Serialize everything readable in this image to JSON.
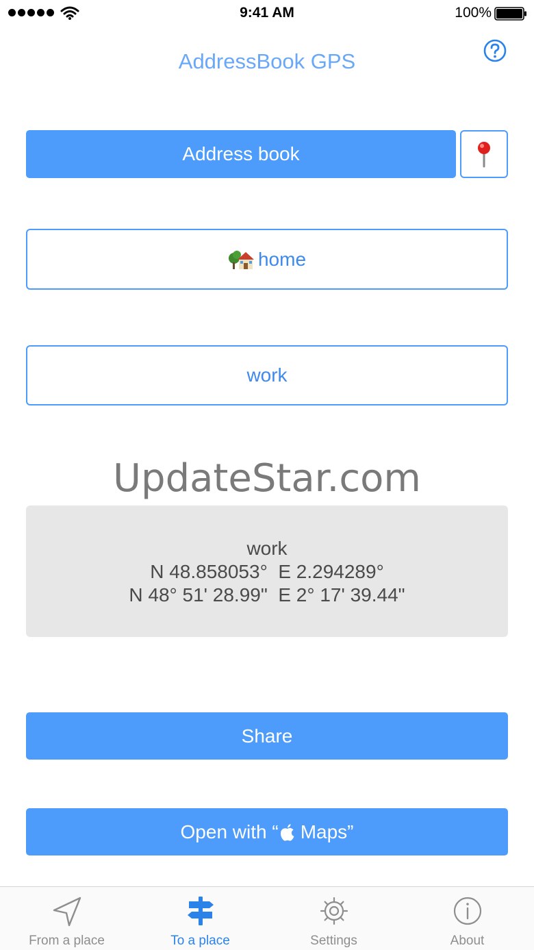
{
  "status_bar": {
    "time": "9:41 AM",
    "battery": "100%"
  },
  "header": {
    "title": "AddressBook GPS",
    "help_icon": "question-circle-icon"
  },
  "buttons": {
    "address_book": "Address book",
    "pin_icon": "map-pin-icon",
    "home": "home",
    "home_icon": "house-icon",
    "work": "work",
    "share": "Share",
    "open_maps_prefix": "Open with “",
    "open_maps_suffix": " Maps”",
    "apple_icon": "apple-logo-icon"
  },
  "watermark": "UpdateStar.com",
  "location": {
    "name": "work",
    "decimal": "N 48.858053°  E 2.294289°",
    "dms": "N 48° 51' 28.99\"  E 2° 17' 39.44\""
  },
  "tabs": [
    {
      "label": "From a place",
      "icon": "location-arrow-icon"
    },
    {
      "label": "To a place",
      "icon": "signpost-icon"
    },
    {
      "label": "Settings",
      "icon": "gear-icon"
    },
    {
      "label": "About",
      "icon": "info-circle-icon"
    }
  ],
  "colors": {
    "accent": "#4d9bfb",
    "title": "#6aa8f7",
    "panel": "#e7e7e7",
    "tab_active": "#2b83ea",
    "tab_inactive": "#8e8e8e"
  }
}
